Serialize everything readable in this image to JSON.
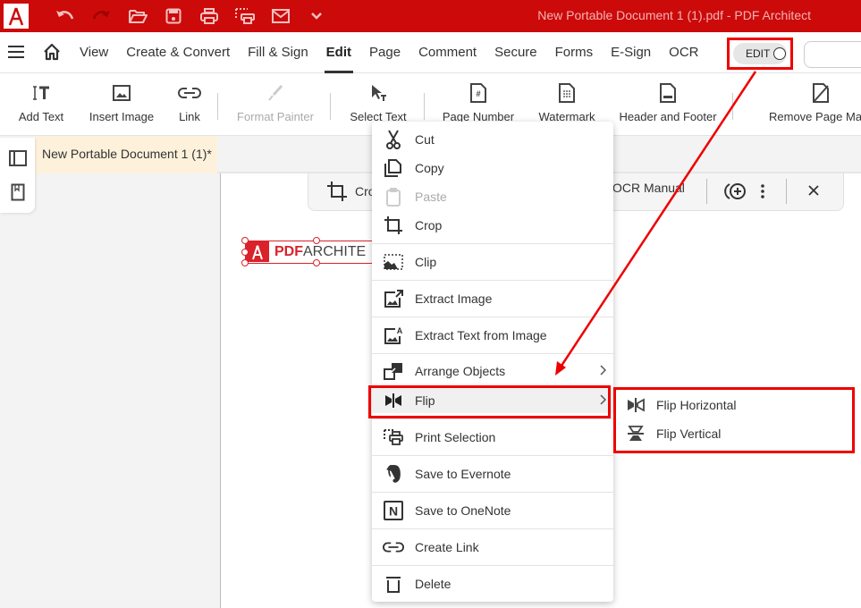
{
  "window": {
    "title": "New Portable Document 1 (1).pdf   -   PDF Architect",
    "brand_color": "#cc0a0a",
    "quick_access": [
      "undo-icon",
      "redo-icon",
      "open-folder-icon",
      "save-icon",
      "print-icon",
      "print-selection-icon",
      "email-icon",
      "chevron-down-icon"
    ]
  },
  "menubar": {
    "tabs": [
      "View",
      "Create & Convert",
      "Fill & Sign",
      "Edit",
      "Page",
      "Comment",
      "Secure",
      "Forms",
      "E-Sign",
      "OCR"
    ],
    "active_tab": "Edit",
    "edit_toggle_label": "EDIT"
  },
  "ribbon": {
    "buttons": [
      {
        "label": "Add Text",
        "icon": "add-text-icon",
        "enabled": true
      },
      {
        "label": "Insert Image",
        "icon": "image-icon",
        "enabled": true
      },
      {
        "label": "Link",
        "icon": "link-icon",
        "enabled": true
      },
      {
        "label": "Format Painter",
        "icon": "brush-icon",
        "enabled": false
      },
      {
        "label": "Select Text",
        "icon": "select-text-icon",
        "enabled": true
      },
      {
        "label": "Page Number",
        "icon": "page-number-icon",
        "enabled": true
      },
      {
        "label": "Watermark",
        "icon": "watermark-icon",
        "enabled": true
      },
      {
        "label": "Header and Footer",
        "icon": "header-footer-icon",
        "enabled": true
      },
      {
        "label": "Remove Page Ma",
        "icon": "remove-page-marks-icon",
        "enabled": true
      }
    ]
  },
  "document": {
    "tab_label": "New Portable Document 1 (1)*",
    "floatbar": {
      "crop_label": "Cro",
      "ocr_label": "OCR Manual"
    },
    "logo": {
      "pdf_text": "PDF",
      "arch_text": "ARCHITE"
    }
  },
  "context_menu": {
    "items": [
      {
        "label": "Cut",
        "icon": "scissors-icon",
        "enabled": true
      },
      {
        "label": "Copy",
        "icon": "copy-icon",
        "enabled": true
      },
      {
        "label": "Paste",
        "icon": "paste-icon",
        "enabled": false
      },
      {
        "label": "Crop",
        "icon": "crop-icon",
        "enabled": true
      },
      {
        "label": "Clip",
        "icon": "clip-icon",
        "enabled": true
      },
      {
        "label": "Extract Image",
        "icon": "extract-image-icon",
        "enabled": true
      },
      {
        "label": "Extract Text from Image",
        "icon": "extract-text-icon",
        "enabled": true
      },
      {
        "label": "Arrange Objects",
        "icon": "arrange-icon",
        "enabled": true,
        "submenu": true
      },
      {
        "label": "Flip",
        "icon": "flip-icon",
        "enabled": true,
        "submenu": true,
        "highlighted": true
      },
      {
        "label": "Print Selection",
        "icon": "print-selection-icon",
        "enabled": true
      },
      {
        "label": "Save to Evernote",
        "icon": "evernote-icon",
        "enabled": true
      },
      {
        "label": "Save to OneNote",
        "icon": "onenote-icon",
        "enabled": true
      },
      {
        "label": "Create Link",
        "icon": "link-icon",
        "enabled": true
      },
      {
        "label": "Delete",
        "icon": "trash-icon",
        "enabled": true
      }
    ],
    "chevron": ">"
  },
  "submenu": {
    "items": [
      {
        "label": "Flip Horizontal",
        "icon": "flip-horizontal-icon"
      },
      {
        "label": "Flip Vertical",
        "icon": "flip-vertical-icon"
      }
    ]
  },
  "annotation_color": "#ee0000"
}
